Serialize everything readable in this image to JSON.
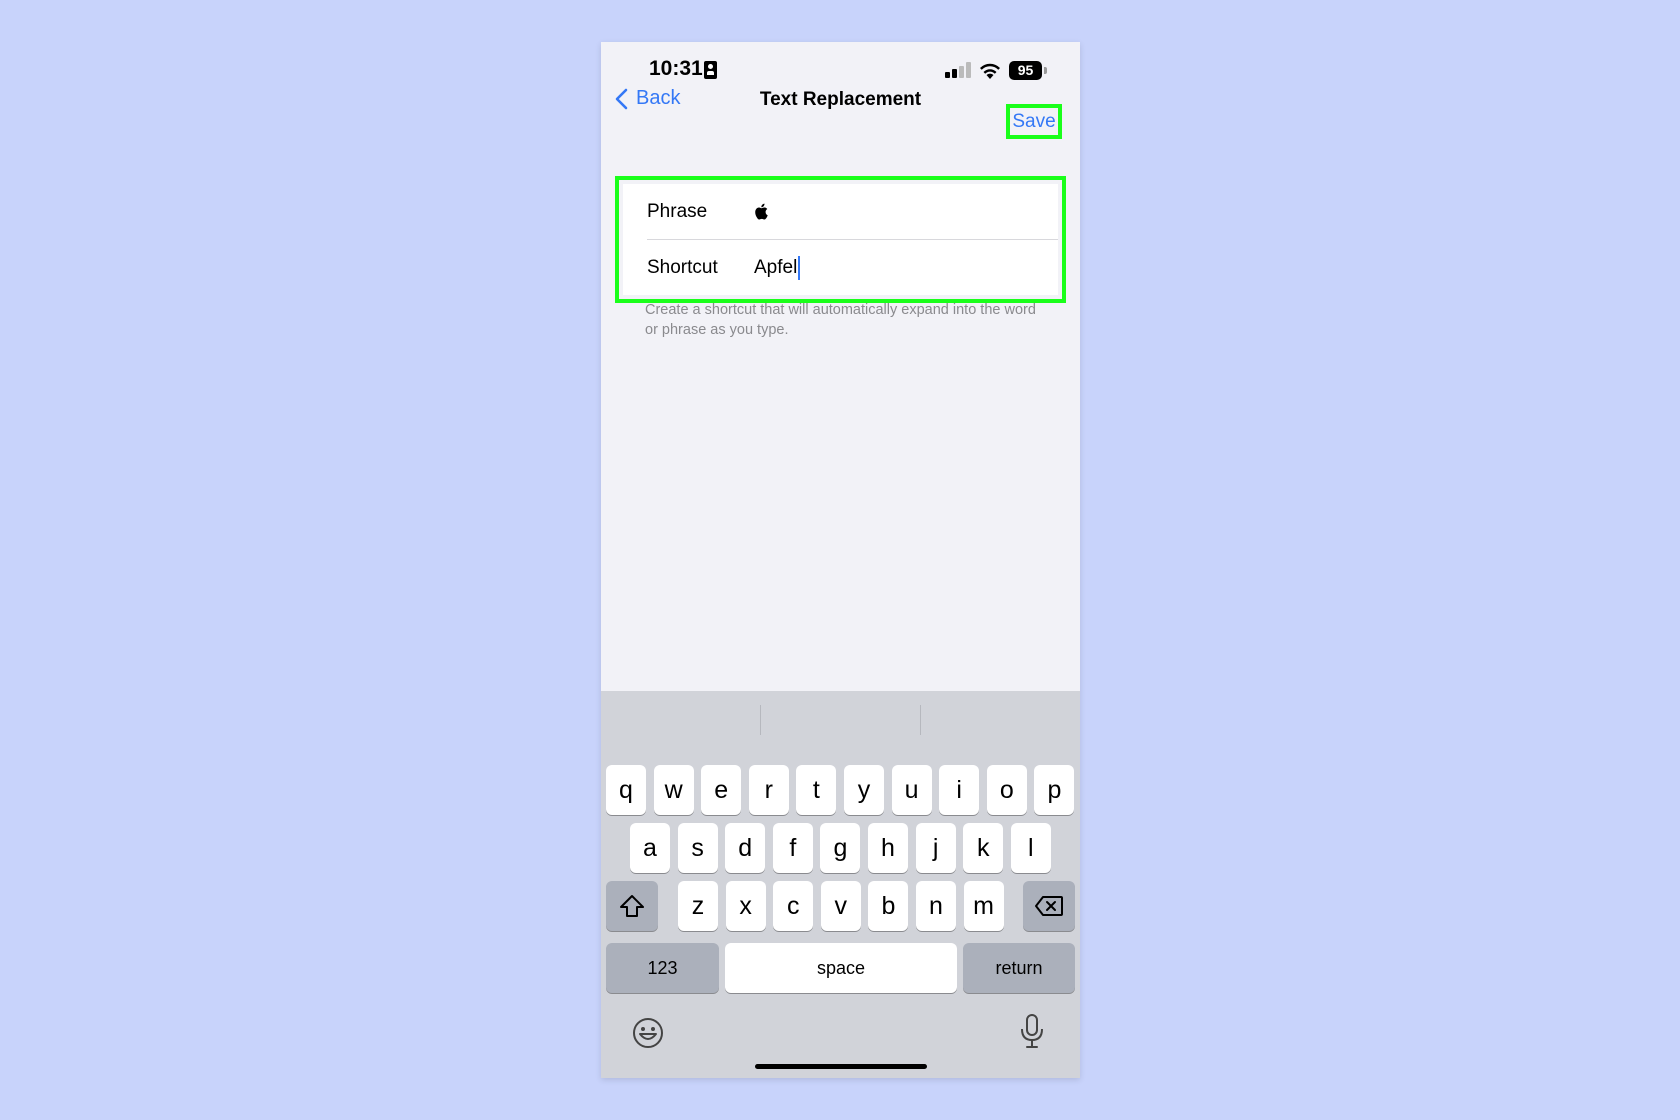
{
  "status_bar": {
    "time": "10:31",
    "battery": "95"
  },
  "nav": {
    "back_label": "Back",
    "title": "Text Replacement",
    "save_label": "Save"
  },
  "form": {
    "phrase_label": "Phrase",
    "phrase_value": "",
    "shortcut_label": "Shortcut",
    "shortcut_value": "Apfel",
    "footer": "Create a shortcut that will automatically expand into the word or phrase as you type."
  },
  "keyboard": {
    "row1": [
      "q",
      "w",
      "e",
      "r",
      "t",
      "y",
      "u",
      "i",
      "o",
      "p"
    ],
    "row2": [
      "a",
      "s",
      "d",
      "f",
      "g",
      "h",
      "j",
      "k",
      "l"
    ],
    "row3": [
      "z",
      "x",
      "c",
      "v",
      "b",
      "n",
      "m"
    ],
    "numbers_label": "123",
    "space_label": "space",
    "return_label": "return"
  },
  "colors": {
    "accent": "#3478f6",
    "highlight": "#1aff1a",
    "background": "#c8d3fb"
  },
  "icons": [
    "person-id-icon",
    "signal-icon",
    "wifi-icon",
    "battery-icon",
    "chevron-left-icon",
    "shift-icon",
    "delete-icon",
    "emoji-icon",
    "microphone-icon"
  ]
}
